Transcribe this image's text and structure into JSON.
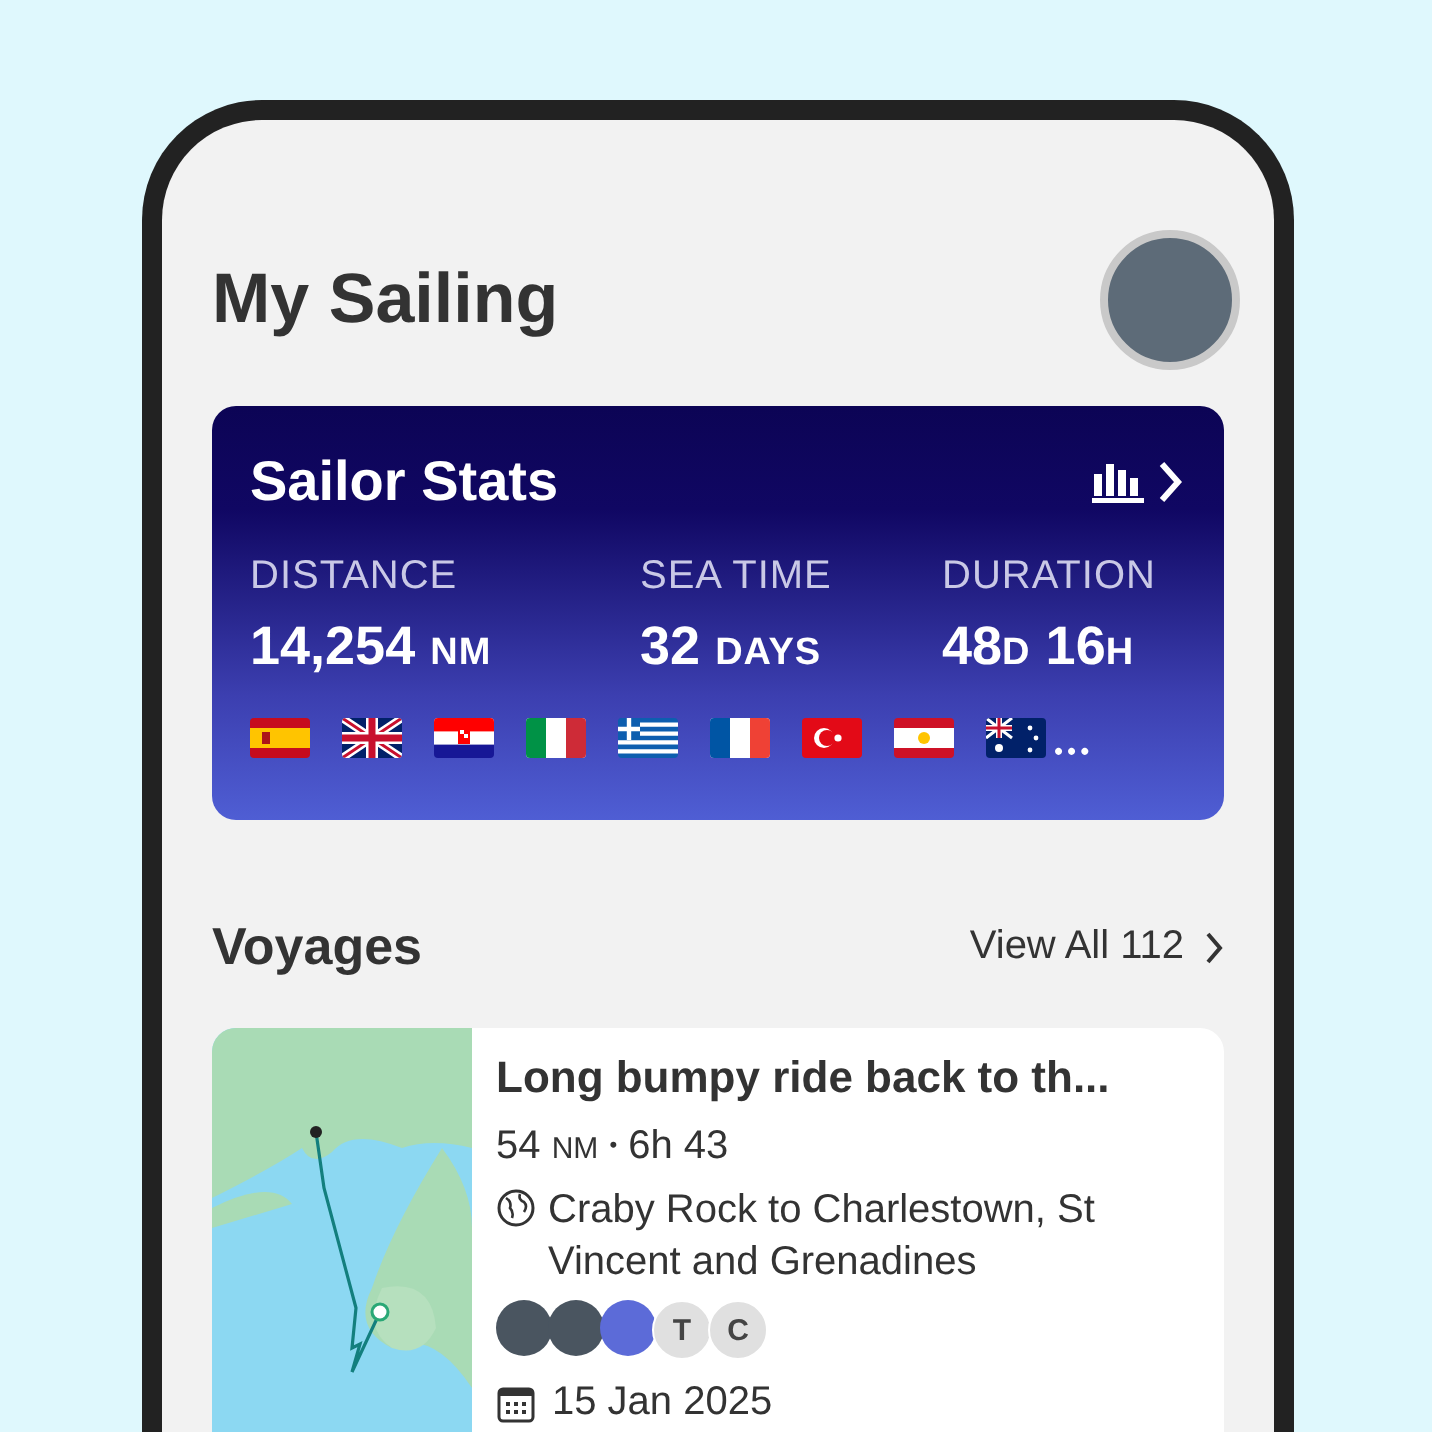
{
  "header": {
    "title": "My Sailing"
  },
  "stats": {
    "title": "Sailor Stats",
    "items": [
      {
        "label": "DISTANCE",
        "parts": [
          {
            "kind": "number",
            "text": "14,254"
          },
          {
            "kind": "unit",
            "text": "NM"
          }
        ]
      },
      {
        "label": "SEA TIME",
        "parts": [
          {
            "kind": "number",
            "text": "32"
          },
          {
            "kind": "unit",
            "text": "DAYS"
          }
        ]
      },
      {
        "label": "DURATION",
        "parts": [
          {
            "kind": "number",
            "text": "48"
          },
          {
            "kind": "unit",
            "text": "D"
          },
          {
            "kind": "number",
            "text": "16"
          },
          {
            "kind": "unit",
            "text": "H"
          }
        ]
      }
    ],
    "flags": [
      {
        "kind": "es"
      },
      {
        "kind": "gb"
      },
      {
        "kind": "hr"
      },
      {
        "kind": "it"
      },
      {
        "kind": "gr"
      },
      {
        "kind": "fr"
      },
      {
        "kind": "tr"
      },
      {
        "kind": "pf"
      },
      {
        "kind": "au"
      }
    ],
    "more": "•••"
  },
  "voyages": {
    "title": "Voyages",
    "view_all": "View All 112",
    "items": [
      {
        "title": "Long bumpy ride back to th...",
        "meta": [
          {
            "kind": "number",
            "text": "54"
          },
          {
            "kind": "unit",
            "text": "NM"
          },
          {
            "kind": "sep",
            "text": "•"
          },
          {
            "kind": "number",
            "text": "6h 43"
          }
        ],
        "route": "Craby Rock to Charlestown, St Vincent and Grenadines",
        "crew": [
          {
            "kind": "photo"
          },
          {
            "kind": "photo"
          },
          {
            "kind": "photo"
          },
          {
            "kind": "initial",
            "text": "T"
          },
          {
            "kind": "initial",
            "text": "C"
          }
        ],
        "date": "15 Jan 2025"
      }
    ]
  }
}
